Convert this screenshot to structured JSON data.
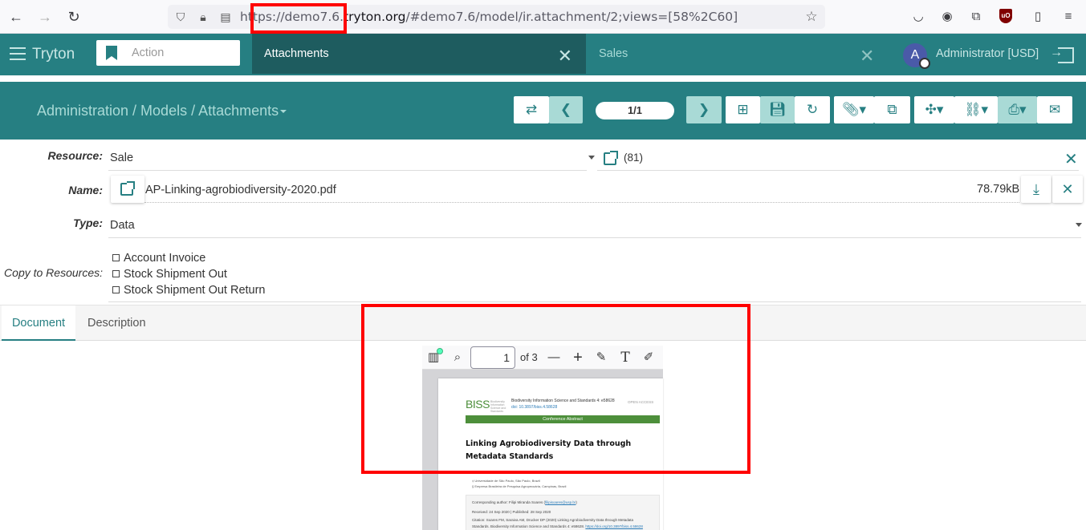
{
  "browser": {
    "url_prefix": "https://demo7.6.",
    "url_host": "tryton.org",
    "url_suffix": "/#demo7.6/model/ir.attachment/2;views=[58%2C60]"
  },
  "header": {
    "brand": "Tryton",
    "action_placeholder": "Action",
    "tabs": [
      {
        "label": "Attachments",
        "active": true
      },
      {
        "label": "Sales",
        "active": false
      }
    ],
    "avatar_letter": "A",
    "user": "Administrator [USD]"
  },
  "toolbar": {
    "breadcrumb": "Administration / Models / Attachments",
    "pager": "1/1"
  },
  "form": {
    "resource_label": "Resource:",
    "resource_value": "Sale",
    "resource_ref": "(81)",
    "name_label": "Name:",
    "name_value": "AP-Linking-agrobiodiversity-2020.pdf",
    "file_size": "78.79kB",
    "type_label": "Type:",
    "type_value": "Data",
    "copy_label": "Copy to Resources:",
    "copy_items": [
      "Account Invoice",
      "Stock Shipment Out",
      "Stock Shipment Out Return"
    ]
  },
  "tabs": {
    "document": "Document",
    "description": "Description"
  },
  "pdf": {
    "page": "1",
    "of_pages": "of 3",
    "logo": "BISS",
    "logo_sub": "Biodiversity Information Science and Standards",
    "journal": "Biodiversity Information Science and Standards 4: e58628",
    "doi": "doi: 10.3897/biss.4.58628",
    "open_access": "OPEN ACCESS",
    "section": "Conference Abstract",
    "title": "Linking Agrobiodiversity Data through Metadata Standards",
    "aff1": "‡ Universidade de São Paulo, São Paulo, Brazil",
    "aff2": "§ Empresa Brasileira de Pesquisa Agropecuária, Campinas, Brazil",
    "corresponding": "Corresponding author: Filipi Miranda Soares (",
    "corresponding_email": "filipisoares@usp.br",
    "corresponding_end": ")",
    "received": "Received: 24 Sep 2020 | Published: 28 Sep 2020",
    "citation1": "Citation: Soares FM, Saraiva AM, Drucker DP (2020) Linking Agrobiodiversity Data through Metadata",
    "citation2": "Standards. Biodiversity Information Science and Standards 4: e58628.",
    "citation_doi": "https://doi.org/10.3897/biss.4.58628"
  },
  "colors": {
    "teal": "#267f82",
    "teal_dark": "#1e5c5f",
    "highlight": "#ff0000"
  }
}
